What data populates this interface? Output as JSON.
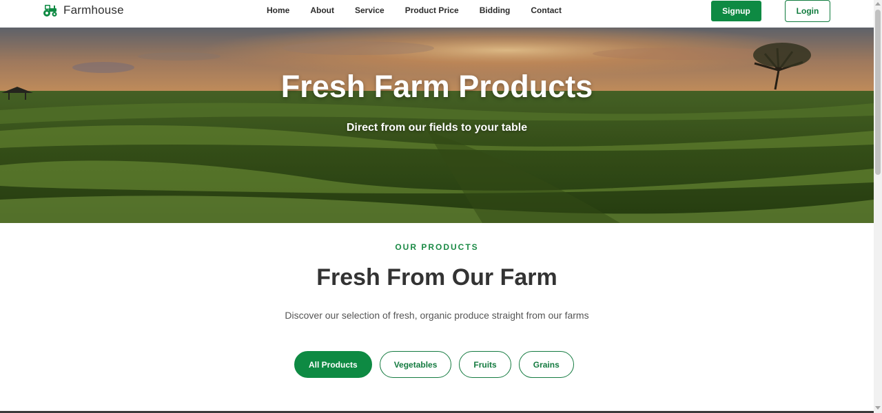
{
  "brand": {
    "name": "Farmhouse",
    "icon": "tractor-icon",
    "color": "#0e8a43"
  },
  "nav": {
    "items": [
      {
        "label": "Home"
      },
      {
        "label": "About"
      },
      {
        "label": "Service"
      },
      {
        "label": "Product Price"
      },
      {
        "label": "Bidding"
      },
      {
        "label": "Contact"
      }
    ]
  },
  "auth": {
    "signup_label": "Signup",
    "login_label": "Login"
  },
  "hero": {
    "title": "Fresh Farm Products",
    "subtitle": "Direct from our fields to your table"
  },
  "products": {
    "eyebrow": "OUR PRODUCTS",
    "title": "Fresh From Our Farm",
    "description": "Discover our selection of fresh, organic produce straight from our farms",
    "filters": [
      {
        "label": "All Products",
        "active": true
      },
      {
        "label": "Vegetables",
        "active": false
      },
      {
        "label": "Fruits",
        "active": false
      },
      {
        "label": "Grains",
        "active": false
      }
    ]
  },
  "colors": {
    "accent": "#0e8a43",
    "text_dark": "#333333"
  }
}
